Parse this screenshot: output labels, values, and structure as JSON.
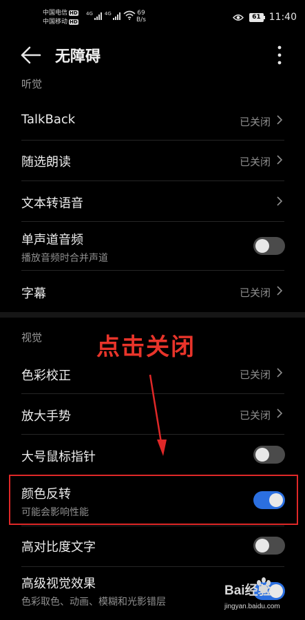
{
  "statusbar": {
    "carrier1": "中国电信",
    "carrier2": "中国移动",
    "hd1": "HD",
    "hd2": "HD",
    "sig1_tag": "4G",
    "sig2_tag": "4G",
    "netspeed_value": "69",
    "netspeed_unit": "B/s",
    "battery": "61",
    "time": "11:40"
  },
  "appbar": {
    "title": "无障碍"
  },
  "sections": {
    "hearing": "听觉",
    "vision": "视觉"
  },
  "rows": {
    "talkback": {
      "title": "TalkBack",
      "status": "已关闭"
    },
    "select_to_speak": {
      "title": "随选朗读",
      "status": "已关闭"
    },
    "tts": {
      "title": "文本转语音"
    },
    "mono_audio": {
      "title": "单声道音频",
      "subtitle": "播放音频时合并声道",
      "toggle": "off"
    },
    "captions": {
      "title": "字幕",
      "status": "已关闭"
    },
    "color_correction": {
      "title": "色彩校正",
      "status": "已关闭"
    },
    "magnification": {
      "title": "放大手势",
      "status": "已关闭"
    },
    "large_pointer": {
      "title": "大号鼠标指针",
      "toggle": "off"
    },
    "color_inversion": {
      "title": "颜色反转",
      "subtitle": "可能会影响性能",
      "toggle": "on"
    },
    "high_contrast": {
      "title": "高对比度文字",
      "toggle": "off"
    },
    "advanced_visual": {
      "title": "高级视觉效果",
      "subtitle": "色彩取色、动画、模糊和光影错层",
      "toggle": "on"
    }
  },
  "annotation": {
    "text": "点击关闭",
    "color": "#e8342a"
  },
  "watermark": {
    "logo": "Bai经验",
    "url": "jingyan.baidu.com"
  },
  "colors": {
    "toggle_on": "#2b6fe0",
    "toggle_off": "#4b4b4b",
    "background": "#000000"
  }
}
